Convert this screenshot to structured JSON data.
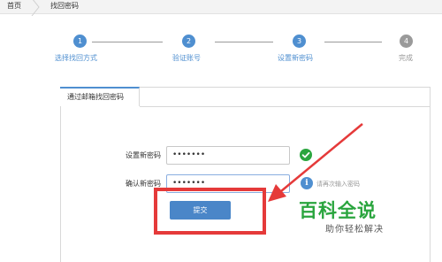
{
  "breadcrumb": {
    "home": "首页",
    "current": "找回密码"
  },
  "steps": [
    {
      "number": "1",
      "label": "选择找回方式",
      "state": "active"
    },
    {
      "number": "2",
      "label": "验证账号",
      "state": "active"
    },
    {
      "number": "3",
      "label": "设置新密码",
      "state": "active"
    },
    {
      "number": "4",
      "label": "完成",
      "state": "inactive"
    }
  ],
  "panel": {
    "tab_label": "通过邮箱找回密码"
  },
  "form": {
    "new_password_label": "设置新密码",
    "new_password_value": "•••••••",
    "confirm_password_label": "确认新密码",
    "confirm_password_value": "•••••••",
    "confirm_hint": "请再次输入密码",
    "submit_label": "提交"
  },
  "watermark": {
    "title": "百科全说",
    "subtitle": "助你轻松解决"
  },
  "colors": {
    "accent": "#4f8fd0",
    "success": "#2aa53e",
    "annotation": "#e53a3a"
  }
}
